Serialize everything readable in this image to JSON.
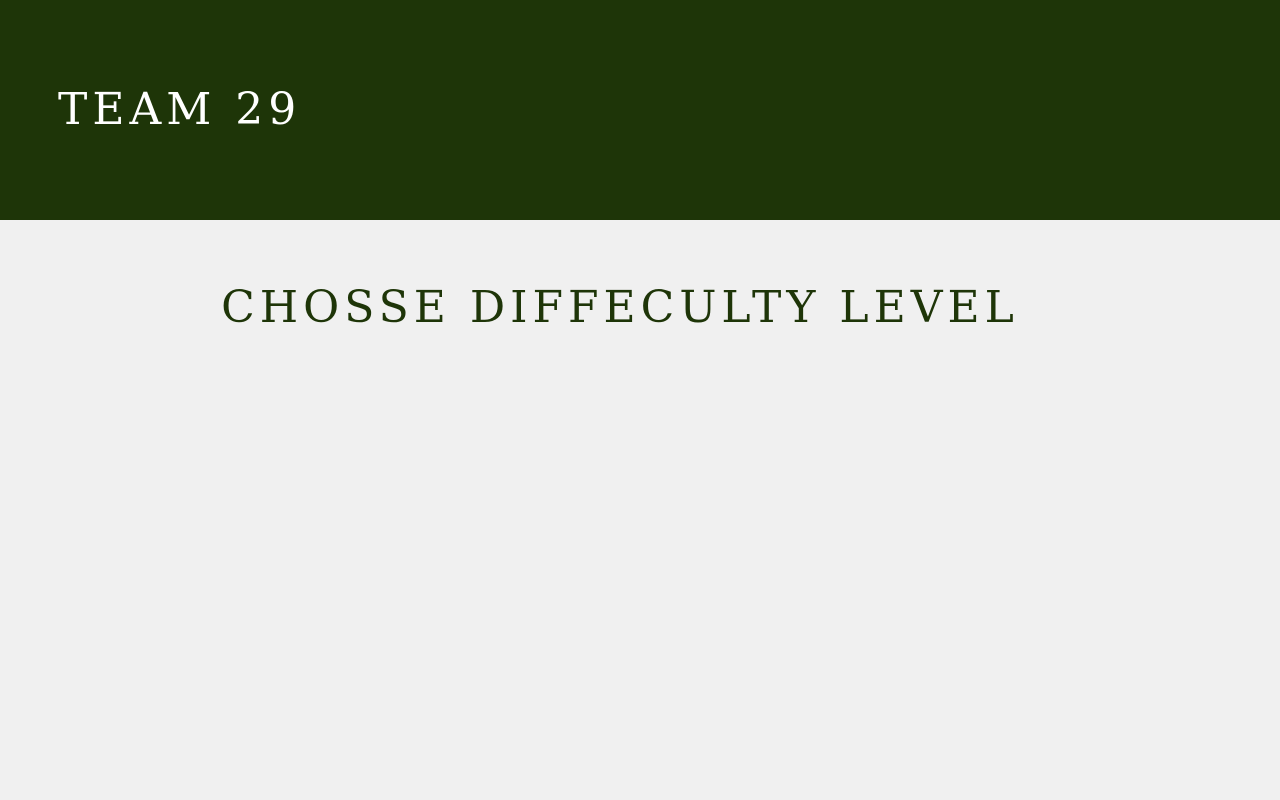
{
  "header": {
    "brand": "TEAM 29"
  },
  "main": {
    "heading": "CHOSSE DIFFECULTY LEVEL"
  },
  "colors": {
    "header_background": "#1e3508",
    "page_background": "#f0f0f0",
    "heading_text": "#1e3508",
    "brand_text": "#ffffff"
  }
}
